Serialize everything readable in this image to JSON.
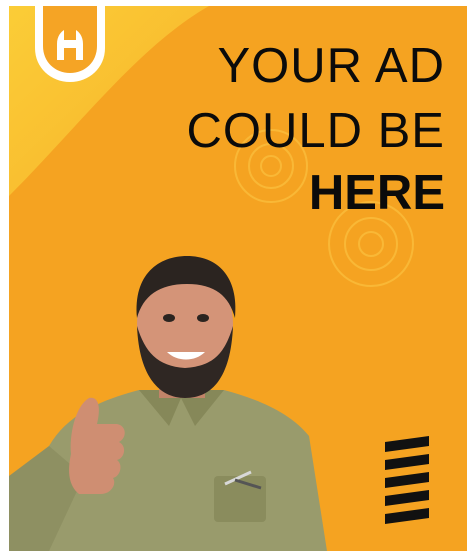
{
  "headline": {
    "line1": "YOUR AD",
    "line2": "COULD BE",
    "line3": "HERE"
  },
  "icons": {
    "logo": "wrench-logo-icon",
    "decor": "gear-icon",
    "stripes": "stripes-icon"
  },
  "colors": {
    "background": "#f6a623",
    "highlight": "#f9c531",
    "text": "#0b0b0b",
    "shirt": "#9a9c6e",
    "logo": "#f5a425"
  }
}
